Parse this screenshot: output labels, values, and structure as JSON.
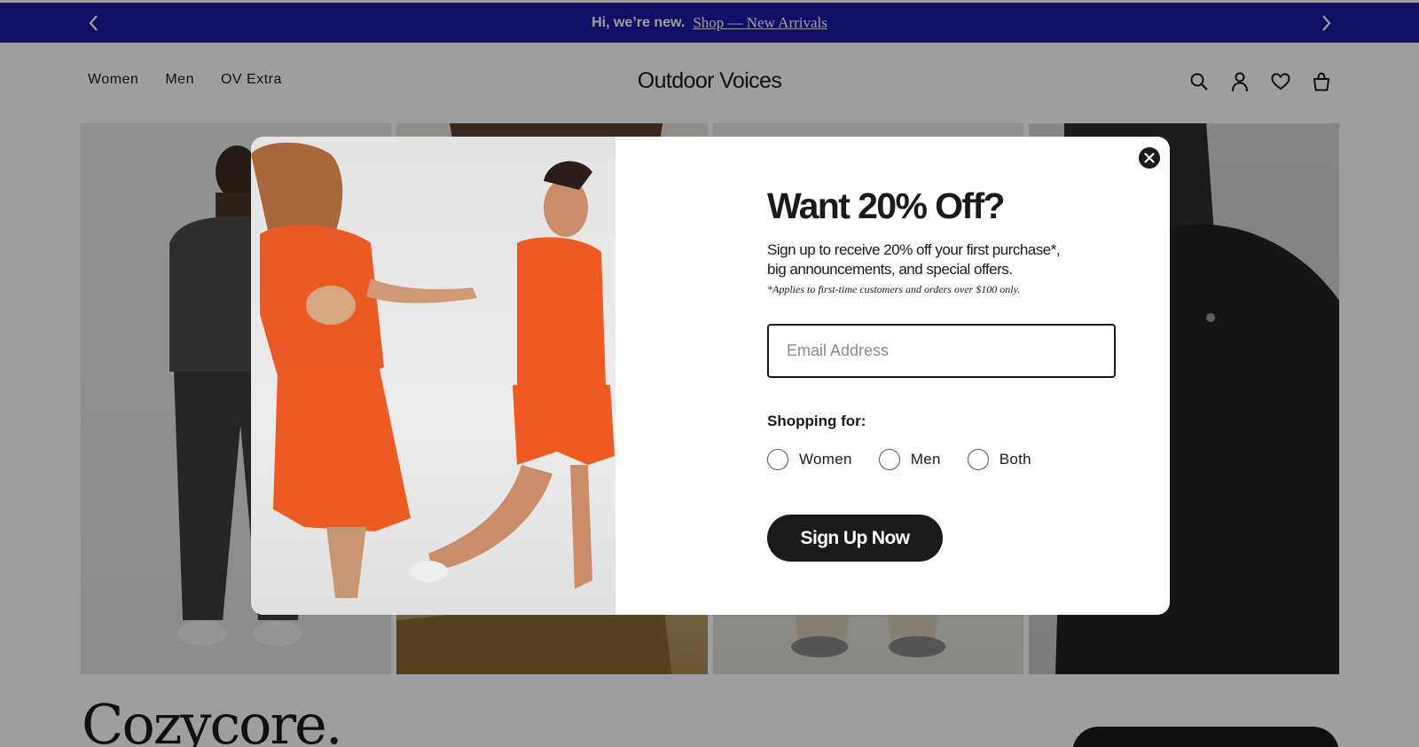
{
  "announcement": {
    "message": "Hi, we’re new.",
    "link": "Shop — New Arrivals"
  },
  "header": {
    "nav": [
      "Women",
      "Men",
      "OV Extra"
    ],
    "logo": "Outdoor Voices",
    "icons": [
      "search-icon",
      "account-icon",
      "wishlist-heart-icon",
      "bag-icon"
    ]
  },
  "page": {
    "section_title": "Cozycore."
  },
  "modal": {
    "title": "Want 20% Off?",
    "subtitle_line1": "Sign up to receive 20% off your first purchase*,",
    "subtitle_line2": "big announcements, and special offers.",
    "fine_print": "*Applies to first-time customers and orders over $100 only.",
    "email_placeholder": "Email Address",
    "shopping_for_label": "Shopping for:",
    "options": [
      "Women",
      "Men",
      "Both"
    ],
    "submit_label": "Sign Up Now"
  },
  "colors": {
    "announcement_bg": "#1c1aa5",
    "button_bg": "#1a1a1a",
    "overlay": "rgba(0,0,0,0.38)"
  }
}
